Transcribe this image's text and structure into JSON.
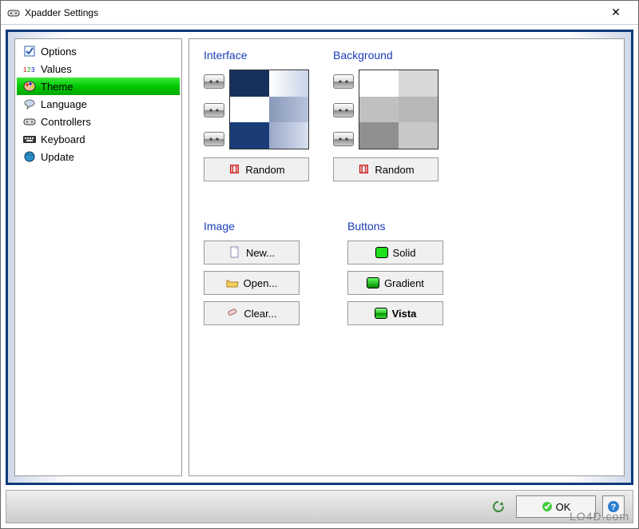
{
  "window": {
    "title": "Xpadder Settings"
  },
  "sidebar": {
    "items": [
      {
        "label": "Options",
        "icon": "checkbox-icon"
      },
      {
        "label": "Values",
        "icon": "digits-icon"
      },
      {
        "label": "Theme",
        "icon": "palette-icon",
        "selected": true
      },
      {
        "label": "Language",
        "icon": "speech-icon"
      },
      {
        "label": "Controllers",
        "icon": "gamepad-icon"
      },
      {
        "label": "Keyboard",
        "icon": "keyboard-icon"
      },
      {
        "label": "Update",
        "icon": "globe-icon"
      }
    ]
  },
  "theme": {
    "interface": {
      "title": "Interface",
      "colors": [
        "#16325c",
        "#ffffff",
        "#ffffff",
        "#1a3d78",
        "#1a3d78",
        "#b8c4dc"
      ],
      "random_label": "Random"
    },
    "background": {
      "title": "Background",
      "colors": [
        "#ffffff",
        "#d8d8d8",
        "#c0c0c0",
        "#b8b8b8",
        "#909090",
        "#c8c8c8"
      ],
      "random_label": "Random"
    },
    "image": {
      "title": "Image",
      "new_label": "New...",
      "open_label": "Open...",
      "clear_label": "Clear..."
    },
    "buttons": {
      "title": "Buttons",
      "solid_label": "Solid",
      "gradient_label": "Gradient",
      "vista_label": "Vista",
      "selected": "Vista"
    }
  },
  "footer": {
    "ok_label": "OK"
  },
  "watermark": "LO4D.com"
}
